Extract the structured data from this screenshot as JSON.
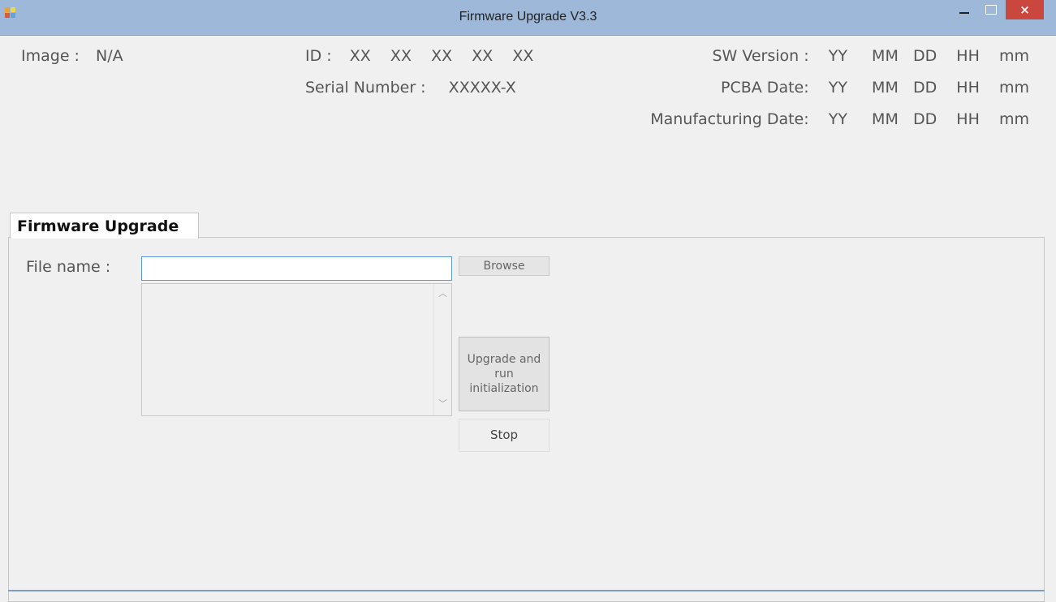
{
  "window": {
    "title": "Firmware Upgrade V3.3",
    "close_glyph": "×"
  },
  "info": {
    "image_label": "Image :",
    "image_value": "N/A",
    "id_label": "ID :",
    "id_values": [
      "XX",
      "XX",
      "XX",
      "XX",
      "XX"
    ],
    "serial_label": "Serial Number :",
    "serial_value": "XXXXX-X",
    "sw_version_label": "SW Version :",
    "pcba_date_label": "PCBA Date:",
    "manufacturing_date_label": "Manufacturing Date:",
    "date_fields": [
      "YY",
      "MM",
      "DD",
      "HH",
      "mm"
    ]
  },
  "tab": {
    "label": "Firmware Upgrade"
  },
  "form": {
    "file_name_label": "File name :",
    "file_name_value": "",
    "browse_label": "Browse",
    "upgrade_label": "Upgrade and run initialization",
    "stop_label": "Stop"
  },
  "colors": {
    "titlebar": "#9db8d9",
    "close_button": "#c9473d",
    "input_border": "#5b9ad5",
    "background": "#f0f0f0"
  },
  "icons": {
    "app": "app-icon",
    "minimize": "minimize-icon",
    "maximize": "maximize-icon",
    "close": "close-icon",
    "scroll_up": "chevron-up-icon",
    "scroll_down": "chevron-down-icon"
  }
}
